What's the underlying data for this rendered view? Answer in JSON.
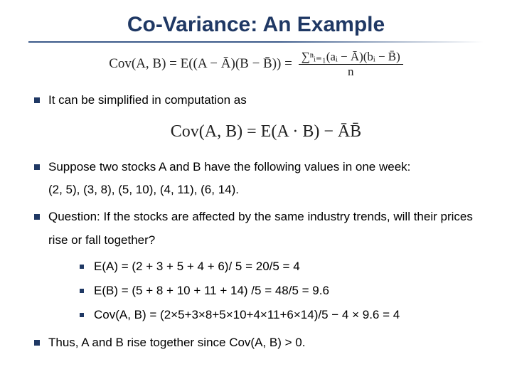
{
  "title": "Co-Variance: An Example",
  "formula_main": {
    "lhs": "Cov(A, B) = E((A − Ā)(B − B̄)) =",
    "num": "∑ⁿᵢ₌₁(aᵢ − Ā)(bᵢ − B̄)",
    "den": "n"
  },
  "bullets": {
    "b1": "It can be simplified in computation as",
    "formula2_text": "Cov(A, B) = E(A · B) − ĀB̄",
    "b2": "Suppose two stocks A and B have the following values in one week:",
    "b2_data": "(2, 5), (3, 8), (5, 10), (4, 11), (6, 14).",
    "b3": "Question:  If the stocks are affected by the same industry trends, will their prices rise or fall together?",
    "sub": {
      "s1": "E(A) = (2 + 3 + 5 + 4 + 6)/ 5 = 20/5 = 4",
      "s2": "E(B) = (5 + 8 + 10 + 11 + 14) /5 = 48/5 = 9.6",
      "s3": "Cov(A, B) = (2×5+3×8+5×10+4×11+6×14)/5 − 4 × 9.6 = 4"
    },
    "b4": "Thus, A and B rise together since Cov(A, B) > 0."
  }
}
